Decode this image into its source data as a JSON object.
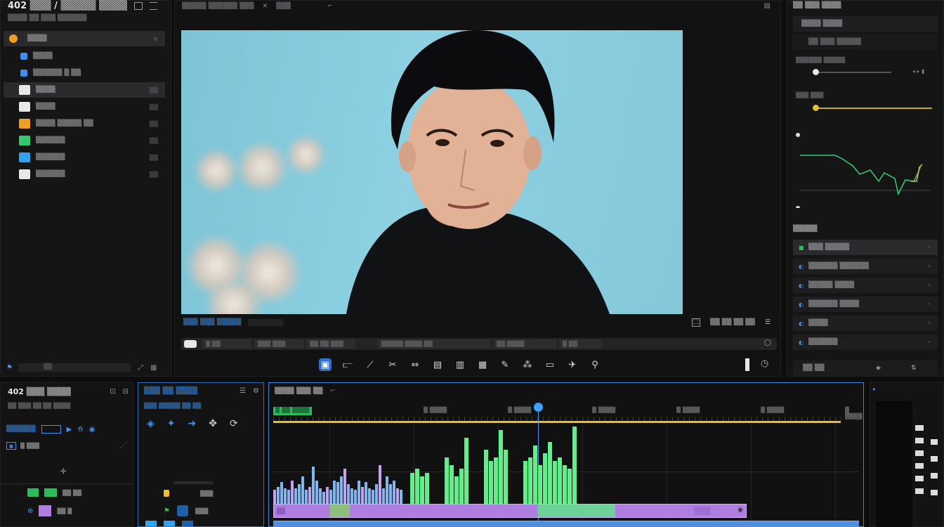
{
  "app": {
    "title": "402 ▒▒▒ / ▒▒▒▒▒ ▒▒▒▒",
    "subtitle": "▒▒▒▒ ▒▒ ▒▒▒ ▒▒▒▒▒▒"
  },
  "media_panel": {
    "bin_label": "▒▒▒▒",
    "items": [
      {
        "label": "▒▒▒▒",
        "count": "",
        "icon": "folder-icon",
        "color": "#3d8ef0"
      },
      {
        "label": "▒▒▒▒▒▒ ▒ ▒▒",
        "count": "",
        "icon": "clip-icon",
        "color": "#3d8ef0"
      },
      {
        "label": "▒▒▒▒",
        "count": "▒▒",
        "icon": "white-square-icon",
        "color": "#e8e8ea"
      },
      {
        "label": "▒▒▒▒",
        "count": "▒▒",
        "icon": "document-icon",
        "color": "#e8e8ea"
      },
      {
        "label": "▒▒▒▒ ▒▒▒▒▒ ▒▒",
        "count": "▒▒",
        "icon": "bell-icon",
        "color": "#f0a020"
      },
      {
        "label": "▒▒▒▒▒▒",
        "count": "▒▒",
        "icon": "green-refresh-icon",
        "color": "#2ecc71"
      },
      {
        "label": "▒▒▒▒▒▒",
        "count": "▒▒",
        "icon": "blue-square-icon",
        "color": "#2fa4f0"
      },
      {
        "label": "▒▒▒▒▒▒",
        "count": "▒▒",
        "icon": "list-icon",
        "color": "#e8e8ea"
      }
    ],
    "footer": "▒▒"
  },
  "viewer": {
    "top_left": "▒▒▒▒▒ ▒▒▒▒▒▒ ▒▒▒",
    "top_mid": "▒▒▒",
    "clip_label": "▒▒▒ ▒▒▒ ▒▒▒▒▒",
    "zoom": "▒▒ ▒▒ ▒▒ ▒▒",
    "transport": [
      "▒ ▒▒",
      "▒▒▒ ▒▒▒",
      "▒▒ ▒▒ ▒▒▒",
      "▒▒▒▒▒ ▒▒▒▒ ▒▒",
      "▒▒ ▒▒▒▒",
      "▒ ▒▒"
    ]
  },
  "inspector": {
    "title": "▒▒ ▒▒▒ ▒▒▒▒",
    "header_row": "▒▒▒▒ ▒▒▒▒",
    "sub_row": "▒▒ ▒▒▒ ▒▒▒▒▒",
    "slider1_label": "▒▒▒▒▒▒ ▒▒▒▒▒",
    "slider2_label": "▒▒▒ ▒▒▒",
    "section_label": "▒▒▒▒▒",
    "rows": [
      "▒▒▒ ▒▒▒▒▒",
      "▒▒▒▒▒▒ ▒▒▒▒▒▒",
      "▒▒▒▒▒ ▒▒▒▒",
      "▒▒▒▒▒▒ ▒▒▒▒",
      "▒▒▒▒",
      "▒▒▒▒▒▒"
    ],
    "footer_left": "▒▒ ▒▒",
    "slider1_level": 0.02,
    "slider2_level": 0.01
  },
  "bottom_left": {
    "title": "402 ▒▒▒ ▒▒▒▒",
    "lines": [
      "▒▒ ▒▒▒ ▒▒",
      "▒▒ ▒▒▒▒"
    ],
    "label_blue": "▒▒▒▒▒▒",
    "track_label": "▒ ▒▒▒",
    "row1": "▒▒ ▒▒",
    "row2": "▒▒ ▒"
  },
  "bottom_mid": {
    "title": "▒▒▒ ▒▒ ▒▒▒▒",
    "subtitle": "▒▒▒ ▒▒▒▒▒ ▒▒ ▒▒",
    "row1": "▒▒▒",
    "row2": "▒▒▒"
  },
  "timeline": {
    "title": "▒▒▒▒ ▒▒▒ ▒▒",
    "marker_label": "▒ ▒▒ ▒▒▒▒",
    "ruler": [
      "▒ ▒▒▒▒",
      "▒ ▒▒▒▒",
      "▒ ▒▒▒▒",
      "▒ ▒▒▒▒",
      "▒ ▒▒▒▒",
      "▒ ▒▒▒▒",
      "▒ ▒▒▒"
    ],
    "bars_blue": [
      0.18,
      0.22,
      0.28,
      0.2,
      0.18,
      0.3,
      0.2,
      0.25,
      0.35,
      0.18,
      0.22,
      0.48,
      0.3,
      0.2,
      0.15,
      0.22,
      0.18,
      0.3,
      0.28,
      0.35,
      0.45,
      0.25,
      0.2,
      0.18,
      0.3,
      0.22,
      0.28,
      0.2,
      0.18,
      0.25,
      0.5,
      0.2,
      0.35,
      0.25,
      0.3,
      0.2,
      0.18
    ],
    "bars_green": [
      0.4,
      0.45,
      0.35,
      0.4,
      0.6,
      0.5,
      0.35,
      0.45,
      0.85,
      0.7,
      0.55,
      0.6,
      0.95,
      0.7,
      0.55,
      0.6,
      0.75,
      0.5,
      0.65,
      0.8,
      0.55,
      0.6,
      0.5,
      0.45,
      1.0
    ]
  },
  "colors": {
    "accent_blue": "#2b74d6",
    "accent_green": "#3ee06a",
    "clip_purple": "#b07ee0",
    "clip_blue": "#4f8fe0",
    "playhead_yellow": "#e0c030"
  }
}
